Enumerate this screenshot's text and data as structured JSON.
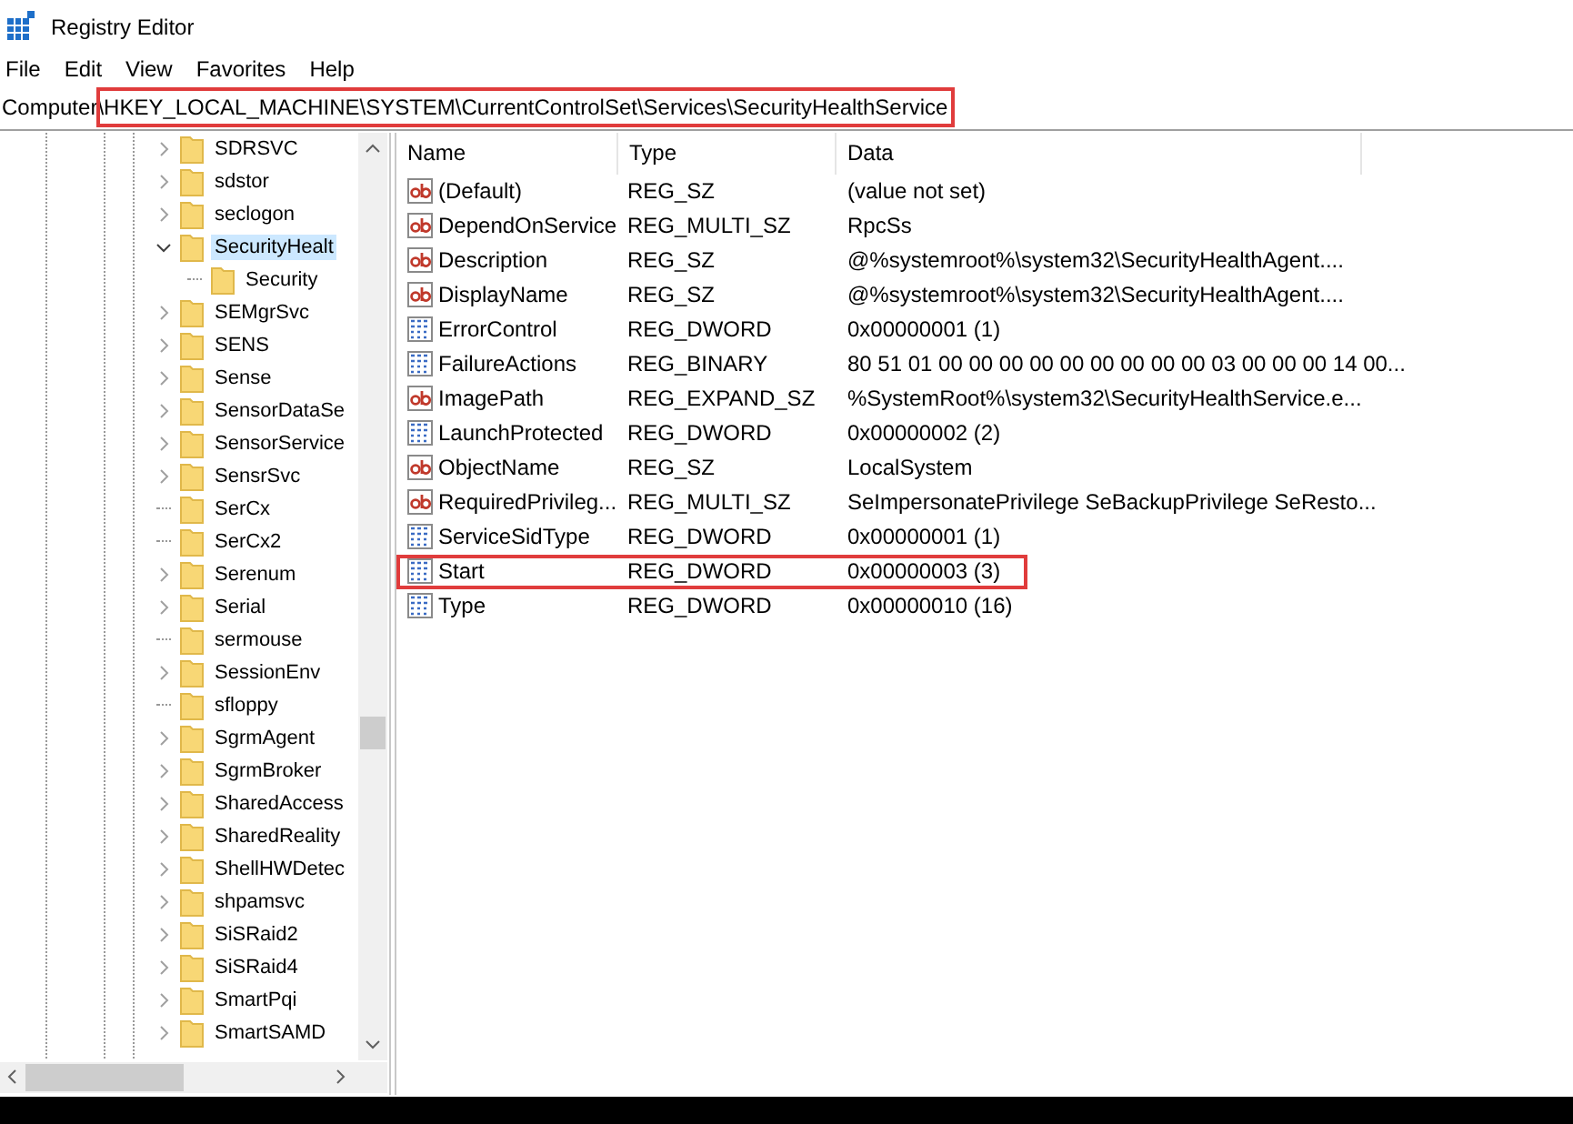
{
  "window": {
    "title": "Registry Editor"
  },
  "menu": [
    "File",
    "Edit",
    "View",
    "Favorites",
    "Help"
  ],
  "address_bar": {
    "value": "Computer\\HKEY_LOCAL_MACHINE\\SYSTEM\\CurrentControlSet\\Services\\SecurityHealthService",
    "highlighted": true
  },
  "tree": {
    "items": [
      {
        "label": "SDRSVC",
        "kind": "branch",
        "expanded": false,
        "selected": false
      },
      {
        "label": "sdstor",
        "kind": "branch",
        "expanded": false,
        "selected": false
      },
      {
        "label": "seclogon",
        "kind": "branch",
        "expanded": false,
        "selected": false
      },
      {
        "label": "SecurityHealt",
        "kind": "branch",
        "expanded": true,
        "selected": true,
        "children": [
          {
            "label": "Security",
            "kind": "leaf",
            "selected": false
          }
        ]
      },
      {
        "label": "SEMgrSvc",
        "kind": "branch",
        "expanded": false,
        "selected": false
      },
      {
        "label": "SENS",
        "kind": "branch",
        "expanded": false,
        "selected": false
      },
      {
        "label": "Sense",
        "kind": "branch",
        "expanded": false,
        "selected": false
      },
      {
        "label": "SensorDataSe",
        "kind": "branch",
        "expanded": false,
        "selected": false
      },
      {
        "label": "SensorService",
        "kind": "branch",
        "expanded": false,
        "selected": false
      },
      {
        "label": "SensrSvc",
        "kind": "branch",
        "expanded": false,
        "selected": false
      },
      {
        "label": "SerCx",
        "kind": "leaf",
        "selected": false
      },
      {
        "label": "SerCx2",
        "kind": "leaf",
        "selected": false
      },
      {
        "label": "Serenum",
        "kind": "branch",
        "expanded": false,
        "selected": false
      },
      {
        "label": "Serial",
        "kind": "branch",
        "expanded": false,
        "selected": false
      },
      {
        "label": "sermouse",
        "kind": "leaf",
        "selected": false
      },
      {
        "label": "SessionEnv",
        "kind": "branch",
        "expanded": false,
        "selected": false
      },
      {
        "label": "sfloppy",
        "kind": "leaf",
        "selected": false
      },
      {
        "label": "SgrmAgent",
        "kind": "branch",
        "expanded": false,
        "selected": false
      },
      {
        "label": "SgrmBroker",
        "kind": "branch",
        "expanded": false,
        "selected": false
      },
      {
        "label": "SharedAccess",
        "kind": "branch",
        "expanded": false,
        "selected": false
      },
      {
        "label": "SharedReality",
        "kind": "branch",
        "expanded": false,
        "selected": false
      },
      {
        "label": "ShellHWDetec",
        "kind": "branch",
        "expanded": false,
        "selected": false
      },
      {
        "label": "shpamsvc",
        "kind": "branch",
        "expanded": false,
        "selected": false
      },
      {
        "label": "SiSRaid2",
        "kind": "branch",
        "expanded": false,
        "selected": false
      },
      {
        "label": "SiSRaid4",
        "kind": "branch",
        "expanded": false,
        "selected": false
      },
      {
        "label": "SmartPqi",
        "kind": "branch",
        "expanded": false,
        "selected": false
      },
      {
        "label": "SmartSAMD",
        "kind": "branch",
        "expanded": false,
        "selected": false
      }
    ]
  },
  "values": {
    "columns": [
      "Name",
      "Type",
      "Data"
    ],
    "rows": [
      {
        "kind": "string",
        "name": "(Default)",
        "type": "REG_SZ",
        "data": "(value not set)",
        "highlighted": false
      },
      {
        "kind": "string",
        "name": "DependOnService",
        "type": "REG_MULTI_SZ",
        "data": "RpcSs",
        "highlighted": false
      },
      {
        "kind": "string",
        "name": "Description",
        "type": "REG_SZ",
        "data": "@%systemroot%\\system32\\SecurityHealthAgent....",
        "highlighted": false
      },
      {
        "kind": "string",
        "name": "DisplayName",
        "type": "REG_SZ",
        "data": "@%systemroot%\\system32\\SecurityHealthAgent....",
        "highlighted": false
      },
      {
        "kind": "binary",
        "name": "ErrorControl",
        "type": "REG_DWORD",
        "data": "0x00000001 (1)",
        "highlighted": false
      },
      {
        "kind": "binary",
        "name": "FailureActions",
        "type": "REG_BINARY",
        "data": "80 51 01 00 00 00 00 00 00 00 00 00 03 00 00 00 14 00...",
        "highlighted": false
      },
      {
        "kind": "string",
        "name": "ImagePath",
        "type": "REG_EXPAND_SZ",
        "data": "%SystemRoot%\\system32\\SecurityHealthService.e...",
        "highlighted": false
      },
      {
        "kind": "binary",
        "name": "LaunchProtected",
        "type": "REG_DWORD",
        "data": "0x00000002 (2)",
        "highlighted": false
      },
      {
        "kind": "string",
        "name": "ObjectName",
        "type": "REG_SZ",
        "data": "LocalSystem",
        "highlighted": false
      },
      {
        "kind": "string",
        "name": "RequiredPrivileg...",
        "type": "REG_MULTI_SZ",
        "data": "SeImpersonatePrivilege SeBackupPrivilege SeResto...",
        "highlighted": false
      },
      {
        "kind": "binary",
        "name": "ServiceSidType",
        "type": "REG_DWORD",
        "data": "0x00000001 (1)",
        "highlighted": false
      },
      {
        "kind": "binary",
        "name": "Start",
        "type": "REG_DWORD",
        "data": "0x00000003 (3)",
        "highlighted": true
      },
      {
        "kind": "binary",
        "name": "Type",
        "type": "REG_DWORD",
        "data": "0x00000010 (16)",
        "highlighted": false
      }
    ]
  }
}
